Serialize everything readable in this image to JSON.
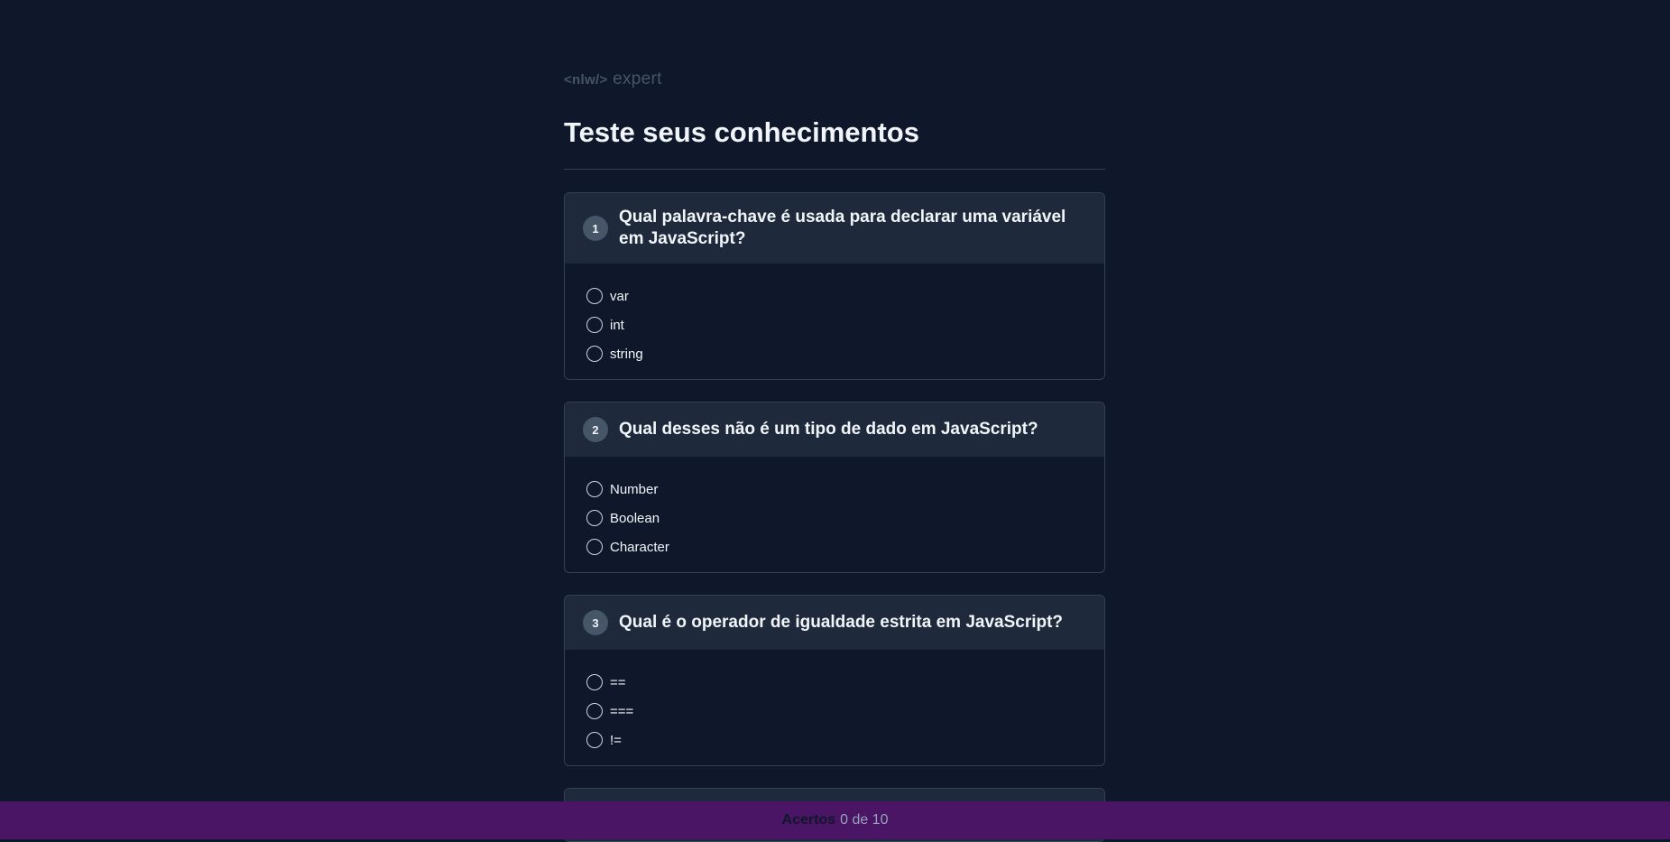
{
  "logo": {
    "tag": "<nlw/>",
    "word": "expert"
  },
  "page_title": "Teste seus conhecimentos",
  "questions": [
    {
      "number": "1",
      "text": "Qual palavra-chave é usada para declarar uma variável em JavaScript?",
      "options": [
        "var",
        "int",
        "string"
      ]
    },
    {
      "number": "2",
      "text": "Qual desses não é um tipo de dado em JavaScript?",
      "options": [
        "Number",
        "Boolean",
        "Character"
      ]
    },
    {
      "number": "3",
      "text": "Qual é o operador de igualdade estrita em JavaScript?",
      "options": [
        "==",
        "===",
        "!="
      ]
    }
  ],
  "footer": {
    "label": "Acertos",
    "score": "0 de 10"
  }
}
